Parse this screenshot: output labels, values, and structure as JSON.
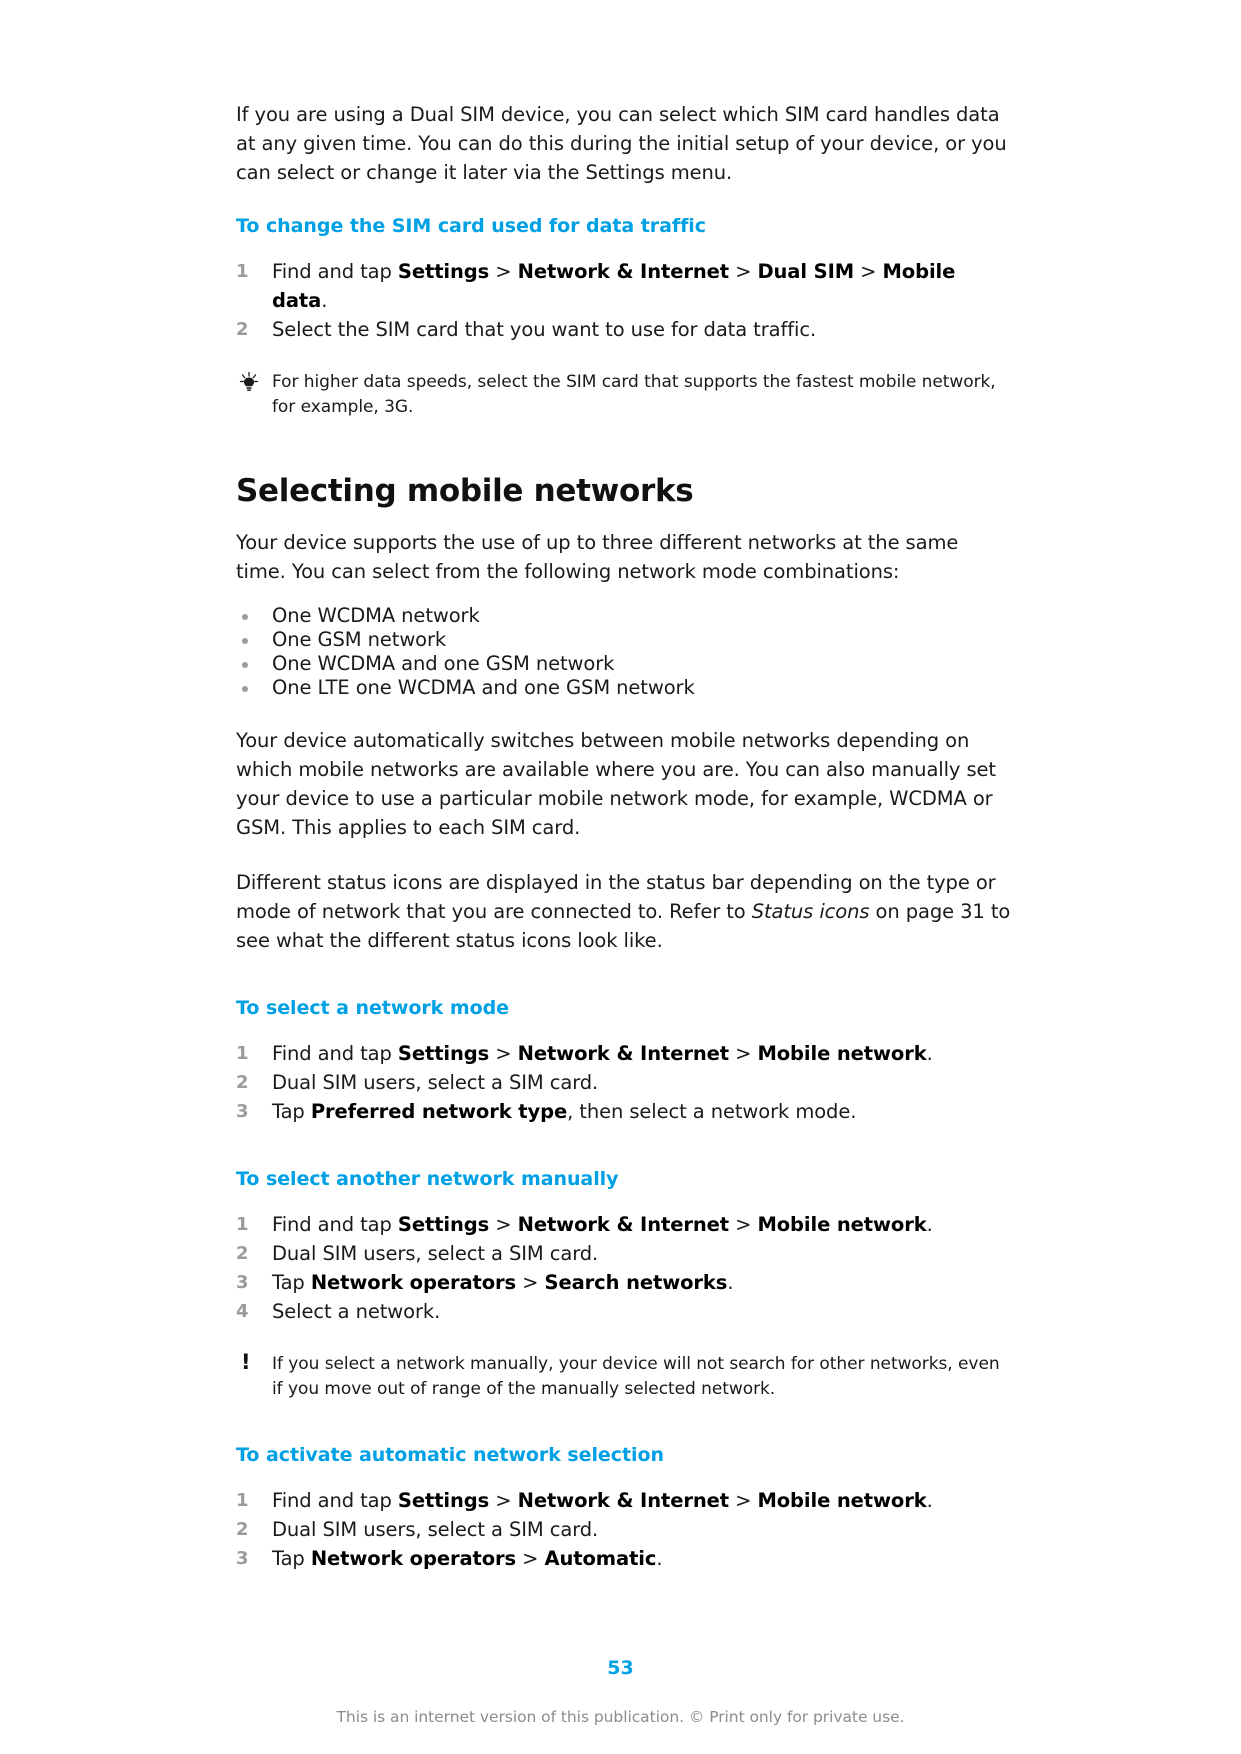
{
  "document": {
    "page_number": "53",
    "footer_note": "This is an internet version of this publication. © Print only for private use.",
    "accent_color": "#00a0e4"
  },
  "intro": {
    "paragraph": "If you are using a Dual SIM device, you can select which SIM card handles data at any given time. You can do this during the initial setup of your device, or you can select or change it later via the Settings menu."
  },
  "procedure_sim_data": {
    "title": "To change the SIM card used for data traffic",
    "steps": [
      {
        "num": "1",
        "parts": [
          {
            "t": "Find and tap ",
            "b": false
          },
          {
            "t": "Settings",
            "b": true
          },
          {
            "t": " > ",
            "b": false
          },
          {
            "t": "Network & Internet",
            "b": true
          },
          {
            "t": " > ",
            "b": false
          },
          {
            "t": "Dual SIM",
            "b": true
          },
          {
            "t": " > ",
            "b": false
          },
          {
            "t": "Mobile data",
            "b": true
          },
          {
            "t": ".",
            "b": false
          }
        ]
      },
      {
        "num": "2",
        "parts": [
          {
            "t": "Select the SIM card that you want to use for data traffic.",
            "b": false
          }
        ]
      }
    ],
    "tip": {
      "icon": "lightbulb-icon",
      "text": "For higher data speeds, select the SIM card that supports the fastest mobile network, for example, 3G."
    }
  },
  "section": {
    "title": "Selecting mobile networks",
    "paragraph_1": "Your device supports the use of up to three different networks at the same time. You can select from the following network mode combinations:",
    "bullets": [
      "One WCDMA network",
      "One GSM network",
      "One WCDMA and one GSM network",
      "One LTE one WCDMA and one GSM network"
    ],
    "paragraph_2": "Your device automatically switches between mobile networks depending on which mobile networks are available where you are. You can also manually set your device to use a particular mobile network mode, for example, WCDMA or GSM. This applies to each SIM card.",
    "paragraph_3": {
      "before": "Different status icons are displayed in the status bar depending on the type or mode of network that you are connected to. Refer to ",
      "italic": "Status icons",
      "after": " on page 31 to see what the different status icons look like."
    }
  },
  "procedure_network_mode": {
    "title": "To select a network mode",
    "steps": [
      {
        "num": "1",
        "parts": [
          {
            "t": "Find and tap ",
            "b": false
          },
          {
            "t": "Settings",
            "b": true
          },
          {
            "t": " > ",
            "b": false
          },
          {
            "t": "Network & Internet",
            "b": true
          },
          {
            "t": " > ",
            "b": false
          },
          {
            "t": "Mobile network",
            "b": true
          },
          {
            "t": ".",
            "b": false
          }
        ]
      },
      {
        "num": "2",
        "parts": [
          {
            "t": "Dual SIM users, select a SIM card.",
            "b": false
          }
        ]
      },
      {
        "num": "3",
        "parts": [
          {
            "t": "Tap ",
            "b": false
          },
          {
            "t": "Preferred network type",
            "b": true
          },
          {
            "t": ", then select a network mode.",
            "b": false
          }
        ]
      }
    ]
  },
  "procedure_manual_network": {
    "title": "To select another network manually",
    "steps": [
      {
        "num": "1",
        "parts": [
          {
            "t": "Find and tap ",
            "b": false
          },
          {
            "t": "Settings",
            "b": true
          },
          {
            "t": " > ",
            "b": false
          },
          {
            "t": "Network & Internet",
            "b": true
          },
          {
            "t": " > ",
            "b": false
          },
          {
            "t": "Mobile network",
            "b": true
          },
          {
            "t": ".",
            "b": false
          }
        ]
      },
      {
        "num": "2",
        "parts": [
          {
            "t": "Dual SIM users, select a SIM card.",
            "b": false
          }
        ]
      },
      {
        "num": "3",
        "parts": [
          {
            "t": "Tap ",
            "b": false
          },
          {
            "t": "Network operators",
            "b": true
          },
          {
            "t": " > ",
            "b": false
          },
          {
            "t": "Search networks",
            "b": true
          },
          {
            "t": ".",
            "b": false
          }
        ]
      },
      {
        "num": "4",
        "parts": [
          {
            "t": "Select a network.",
            "b": false
          }
        ]
      }
    ],
    "warning": {
      "icon": "exclamation-icon",
      "glyph": "!",
      "text": "If you select a network manually, your device will not search for other networks, even if you move out of range of the manually selected network."
    }
  },
  "procedure_automatic_network": {
    "title": "To activate automatic network selection",
    "steps": [
      {
        "num": "1",
        "parts": [
          {
            "t": "Find and tap ",
            "b": false
          },
          {
            "t": "Settings",
            "b": true
          },
          {
            "t": " > ",
            "b": false
          },
          {
            "t": "Network & Internet",
            "b": true
          },
          {
            "t": " > ",
            "b": false
          },
          {
            "t": "Mobile network",
            "b": true
          },
          {
            "t": ".",
            "b": false
          }
        ]
      },
      {
        "num": "2",
        "parts": [
          {
            "t": "Dual SIM users, select a SIM card.",
            "b": false
          }
        ]
      },
      {
        "num": "3",
        "parts": [
          {
            "t": "Tap ",
            "b": false
          },
          {
            "t": "Network operators",
            "b": true
          },
          {
            "t": " > ",
            "b": false
          },
          {
            "t": "Automatic",
            "b": true
          },
          {
            "t": ".",
            "b": false
          }
        ]
      }
    ]
  }
}
